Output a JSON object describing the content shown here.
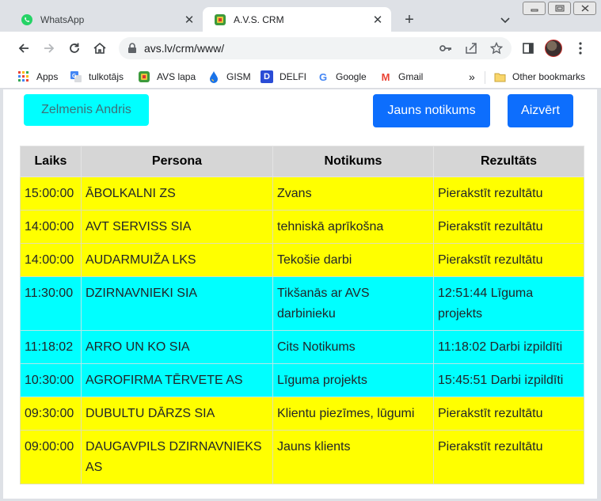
{
  "browser": {
    "tabs": [
      {
        "title": "WhatsApp",
        "active": false,
        "icon": "whatsapp-icon"
      },
      {
        "title": "A.V.S. CRM",
        "active": true,
        "icon": "avs-icon"
      }
    ],
    "new_tab_label": "+",
    "url": "avs.lv/crm/www/",
    "bookmarks": [
      {
        "label": "Apps",
        "icon": "apps-grid-icon"
      },
      {
        "label": "tulkotājs",
        "icon": "translate-icon"
      },
      {
        "label": "AVS lapa",
        "icon": "avs-icon"
      },
      {
        "label": "GISM",
        "icon": "drop-icon"
      },
      {
        "label": "DELFI",
        "icon": "delfi-icon",
        "glyph": "D"
      },
      {
        "label": "Google",
        "icon": "google-icon",
        "glyph": "G"
      },
      {
        "label": "Gmail",
        "icon": "gmail-icon",
        "glyph": "M"
      }
    ],
    "bookmarks_overflow": "»",
    "other_bookmarks": "Other bookmarks"
  },
  "page": {
    "user_name": "Zelmenis Andris",
    "new_event_button": "Jauns notikums",
    "close_button": "Aizvērt",
    "columns": [
      "Laiks",
      "Persona",
      "Notikums",
      "Rezultāts"
    ],
    "rows": [
      {
        "time": "15:00:00",
        "person": "ĀBOLKALNI ZS",
        "event": "Zvans",
        "result": "Pierakstīt rezultātu",
        "color": "yellow"
      },
      {
        "time": "14:00:00",
        "person": "AVT SERVISS SIA",
        "event": "tehniskā aprīkošna",
        "result": "Pierakstīt rezultātu",
        "color": "yellow"
      },
      {
        "time": "14:00:00",
        "person": "AUDARMUIŽA LKS",
        "event": "Tekošie darbi",
        "result": "Pierakstīt rezultātu",
        "color": "yellow"
      },
      {
        "time": "11:30:00",
        "person": "DZIRNAVNIEKI SIA",
        "event": "Tikšanās ar AVS darbinieku",
        "result": "12:51:44 Līguma projekts",
        "color": "cyan"
      },
      {
        "time": "11:18:02",
        "person": "ARRO UN KO SIA",
        "event": "Cits Notikums",
        "result": "11:18:02 Darbi izpildīti",
        "color": "cyan"
      },
      {
        "time": "10:30:00",
        "person": "AGROFIRMA TĒRVETE AS",
        "event": "Līguma projekts",
        "result": "15:45:51 Darbi izpildīti",
        "color": "cyan"
      },
      {
        "time": "09:30:00",
        "person": "DUBULTU DĀRZS SIA",
        "event": "Klientu piezīmes, lūgumi",
        "result": "Pierakstīt rezultātu",
        "color": "yellow"
      },
      {
        "time": "09:00:00",
        "person": "DAUGAVPILS DZIRNAVNIEKS AS",
        "event": "Jauns klients",
        "result": "Pierakstīt rezultātu",
        "color": "yellow"
      }
    ]
  },
  "colors": {
    "pending_row": "#ffff00",
    "done_row": "#00ffff",
    "primary_button": "#0d6efd",
    "header_row": "#d6d6d6"
  }
}
